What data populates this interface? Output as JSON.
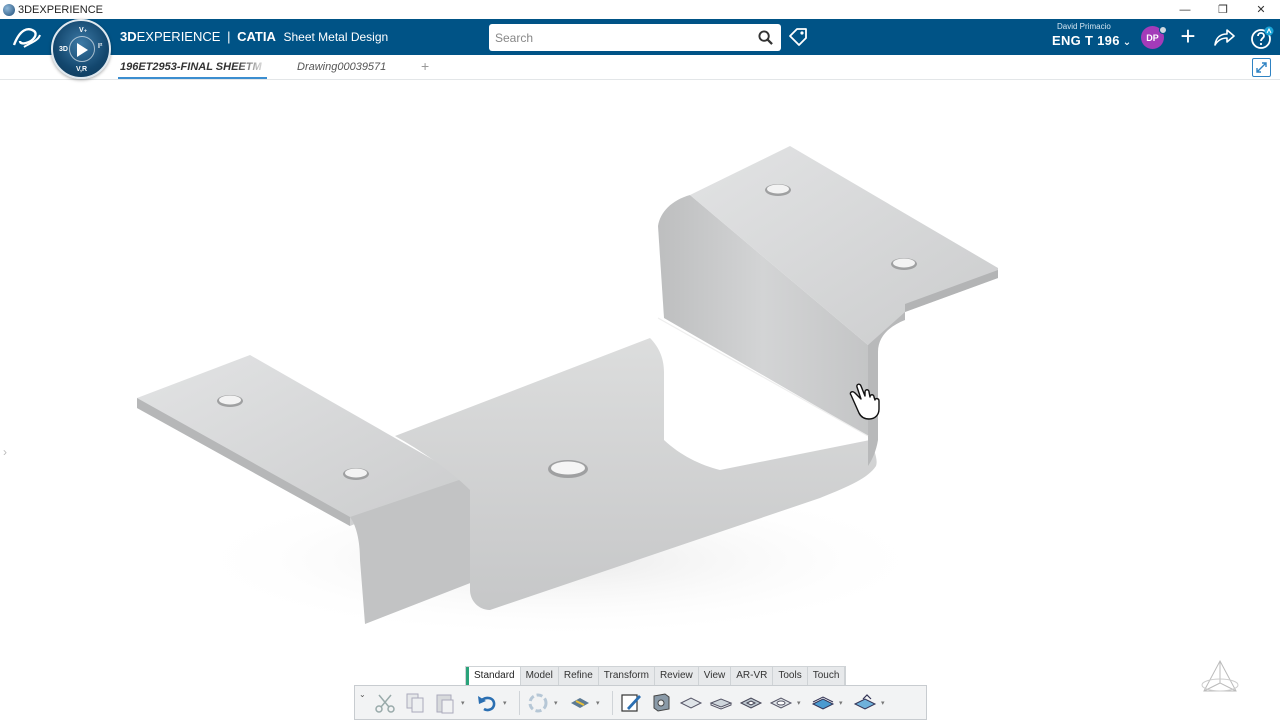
{
  "window": {
    "title": "3DEXPERIENCE",
    "controls": {
      "minimize": "—",
      "restore": "❐",
      "close": "✕"
    }
  },
  "topbar": {
    "brand_prefix": "3D",
    "brand_main": "EXPERIENCE",
    "brand_sep": "|",
    "brand_app": "CATIA",
    "brand_role": "Sheet Metal Design",
    "search_placeholder": "Search",
    "user_name": "David Primacio",
    "tenant": "ENG T 196",
    "tenant_chevron": "⌄",
    "avatar_initials": "DP",
    "add_label": "+"
  },
  "compass": {
    "top": "V₊",
    "left": "3D",
    "right": "I²",
    "bottom": "V,R"
  },
  "tabs": {
    "active_label": "196ET2953-FINAL SHEETM",
    "second_label": "Drawing00039571",
    "add_label": "+"
  },
  "viewport": {
    "side_arrow": "›",
    "corner_tick": "◢"
  },
  "section_tabs": [
    "Standard",
    "Model",
    "Refine",
    "Transform",
    "Review",
    "View",
    "AR-VR",
    "Tools",
    "Touch"
  ],
  "actionbar": {
    "toggle": "⌄",
    "drop": "▾"
  },
  "colors": {
    "topbar": "#005386",
    "accent": "#3b8ed0",
    "avatar": "#a43bb9",
    "active_section": "#2aa37a",
    "part_surface": "#c9cacb"
  }
}
